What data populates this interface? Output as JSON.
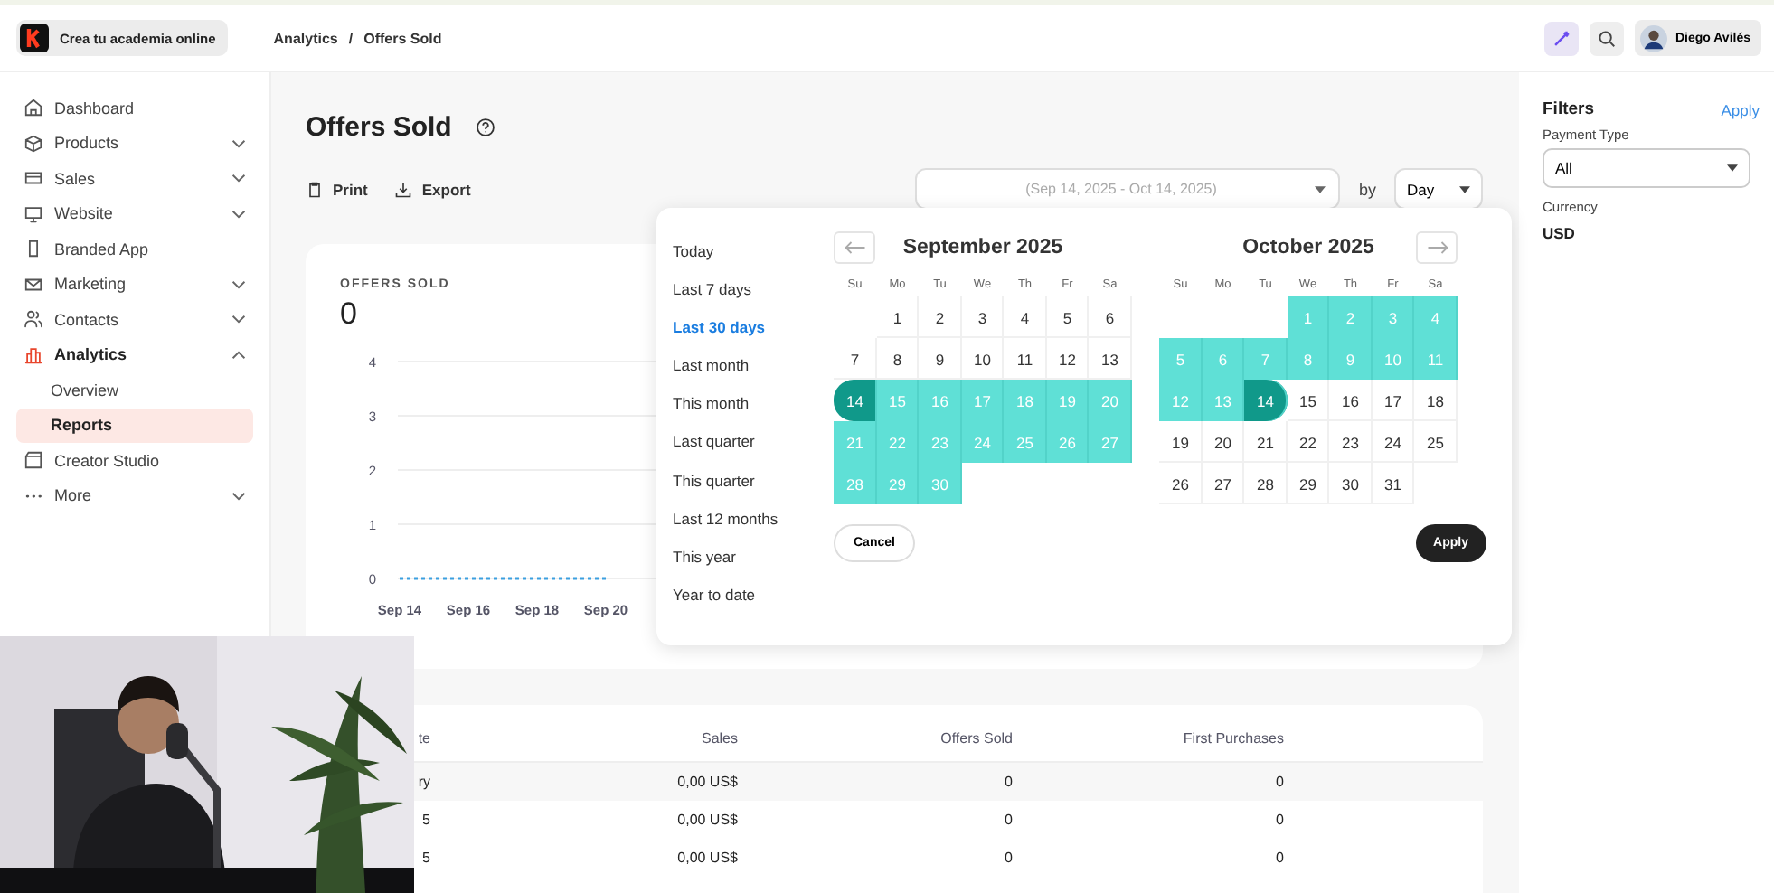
{
  "brand": {
    "name": "Crea tu academia online"
  },
  "breadcrumb": {
    "items": [
      "Analytics",
      "Offers Sold"
    ],
    "separator": "/"
  },
  "user": {
    "name": "Diego Avilés"
  },
  "sidebar": {
    "items": [
      {
        "label": "Dashboard",
        "expandable": false,
        "expanded": false,
        "selected": false
      },
      {
        "label": "Products",
        "expandable": true,
        "expanded": false,
        "selected": false
      },
      {
        "label": "Sales",
        "expandable": true,
        "expanded": false,
        "selected": false
      },
      {
        "label": "Website",
        "expandable": true,
        "expanded": false,
        "selected": false
      },
      {
        "label": "Branded App",
        "expandable": false,
        "expanded": false,
        "selected": false
      },
      {
        "label": "Marketing",
        "expandable": true,
        "expanded": false,
        "selected": false
      },
      {
        "label": "Contacts",
        "expandable": true,
        "expanded": false,
        "selected": false
      },
      {
        "label": "Analytics",
        "expandable": true,
        "expanded": true,
        "selected": false,
        "children": [
          {
            "label": "Overview",
            "selected": false
          },
          {
            "label": "Reports",
            "selected": true
          }
        ]
      },
      {
        "label": "Creator Studio",
        "expandable": false,
        "expanded": false,
        "selected": false
      },
      {
        "label": "More",
        "expandable": true,
        "expanded": false,
        "selected": false
      }
    ]
  },
  "page": {
    "title": "Offers Sold",
    "actions": [
      "Print",
      "Export"
    ],
    "date_range": {
      "placeholder": "(Sep 14, 2025 - Oct 14, 2025)"
    },
    "by_label": "by",
    "interval": "Day"
  },
  "chart_card": {
    "label": "OFFERS SOLD",
    "total": "0",
    "chart_data": {
      "type": "line",
      "categories": [
        "Sep 14",
        "Sep 16",
        "Sep 18",
        "Sep 20"
      ],
      "series": [
        {
          "color": "#3b9fe0",
          "line_style": "dashed",
          "values": [
            0,
            0,
            0,
            0
          ]
        }
      ],
      "ylim": [
        0,
        4
      ],
      "yticks": [
        0,
        1,
        2,
        3,
        4
      ],
      "grid": true
    }
  },
  "date_picker": {
    "presets": [
      {
        "label": "Today",
        "selected": false
      },
      {
        "label": "Last 7 days",
        "selected": false
      },
      {
        "label": "Last 30 days",
        "selected": true
      },
      {
        "label": "Last month",
        "selected": false
      },
      {
        "label": "This month",
        "selected": false
      },
      {
        "label": "Last quarter",
        "selected": false
      },
      {
        "label": "This quarter",
        "selected": false
      },
      {
        "label": "Last 12 months",
        "selected": false
      },
      {
        "label": "This year",
        "selected": false
      },
      {
        "label": "Year to date",
        "selected": false
      }
    ],
    "months": [
      {
        "title": "September 2025",
        "weekdays": [
          "Su",
          "Mo",
          "Tu",
          "We",
          "Th",
          "Fr",
          "Sa"
        ],
        "weeks": [
          [
            {
              "label": "1",
              "kind": "plain"
            },
            {
              "label": "2",
              "kind": "plain"
            },
            {
              "label": "3",
              "kind": "plain"
            },
            {
              "label": "4",
              "kind": "plain"
            },
            {
              "label": "5",
              "kind": "plain"
            },
            {
              "label": "6",
              "kind": "plain"
            }
          ],
          [
            {
              "label": "7",
              "kind": "plain"
            },
            {
              "label": "8",
              "kind": "plain"
            },
            {
              "label": "9",
              "kind": "plain"
            },
            {
              "label": "10",
              "kind": "plain"
            },
            {
              "label": "11",
              "kind": "plain"
            },
            {
              "label": "12",
              "kind": "plain"
            },
            {
              "label": "13",
              "kind": "plain"
            }
          ],
          [
            {
              "label": "14",
              "kind": "start"
            },
            {
              "label": "15",
              "kind": "range"
            },
            {
              "label": "16",
              "kind": "range"
            },
            {
              "label": "17",
              "kind": "range"
            },
            {
              "label": "18",
              "kind": "range"
            },
            {
              "label": "19",
              "kind": "range"
            },
            {
              "label": "20",
              "kind": "range"
            }
          ],
          [
            {
              "label": "21",
              "kind": "range"
            },
            {
              "label": "22",
              "kind": "range"
            },
            {
              "label": "23",
              "kind": "range"
            },
            {
              "label": "24",
              "kind": "range"
            },
            {
              "label": "25",
              "kind": "range"
            },
            {
              "label": "26",
              "kind": "range"
            },
            {
              "label": "27",
              "kind": "range"
            }
          ],
          [
            {
              "label": "28",
              "kind": "range"
            },
            {
              "label": "29",
              "kind": "range"
            },
            {
              "label": "30",
              "kind": "range"
            }
          ]
        ]
      },
      {
        "title": "October 2025",
        "weekdays": [
          "Su",
          "Mo",
          "Tu",
          "We",
          "Th",
          "Fr",
          "Sa"
        ],
        "weeks": [
          [
            {
              "label": "1",
              "kind": "range"
            },
            {
              "label": "2",
              "kind": "range"
            },
            {
              "label": "3",
              "kind": "range"
            },
            {
              "label": "4",
              "kind": "range"
            }
          ],
          [
            {
              "label": "5",
              "kind": "range"
            },
            {
              "label": "6",
              "kind": "range"
            },
            {
              "label": "7",
              "kind": "range"
            },
            {
              "label": "8",
              "kind": "range"
            },
            {
              "label": "9",
              "kind": "range"
            },
            {
              "label": "10",
              "kind": "range"
            },
            {
              "label": "11",
              "kind": "range"
            }
          ],
          [
            {
              "label": "12",
              "kind": "range"
            },
            {
              "label": "13",
              "kind": "range"
            },
            {
              "label": "14",
              "kind": "end"
            },
            {
              "label": "15",
              "kind": "plain"
            },
            {
              "label": "16",
              "kind": "plain"
            },
            {
              "label": "17",
              "kind": "plain"
            },
            {
              "label": "18",
              "kind": "plain"
            }
          ],
          [
            {
              "label": "19",
              "kind": "plain"
            },
            {
              "label": "20",
              "kind": "plain"
            },
            {
              "label": "21",
              "kind": "plain"
            },
            {
              "label": "22",
              "kind": "plain"
            },
            {
              "label": "23",
              "kind": "plain"
            },
            {
              "label": "24",
              "kind": "plain"
            },
            {
              "label": "25",
              "kind": "plain"
            }
          ],
          [
            {
              "label": "26",
              "kind": "plain"
            },
            {
              "label": "27",
              "kind": "plain"
            },
            {
              "label": "28",
              "kind": "plain"
            },
            {
              "label": "29",
              "kind": "plain"
            },
            {
              "label": "30",
              "kind": "plain"
            },
            {
              "label": "31",
              "kind": "plain"
            }
          ]
        ]
      }
    ],
    "buttons": {
      "cancel": "Cancel",
      "apply": "Apply"
    }
  },
  "table": {
    "columns": [
      "te",
      "Sales",
      "Offers Sold",
      "First Purchases"
    ],
    "rows": [
      [
        "ry",
        "0,00 US$",
        "0",
        "0"
      ],
      [
        "5",
        "0,00 US$",
        "0",
        "0"
      ],
      [
        "5",
        "0,00 US$",
        "0",
        "0"
      ]
    ]
  },
  "filters": {
    "title": "Filters",
    "apply": "Apply",
    "payment_type_label": "Payment Type",
    "payment_type": "All",
    "currency_label": "Currency",
    "currency": "USD"
  }
}
